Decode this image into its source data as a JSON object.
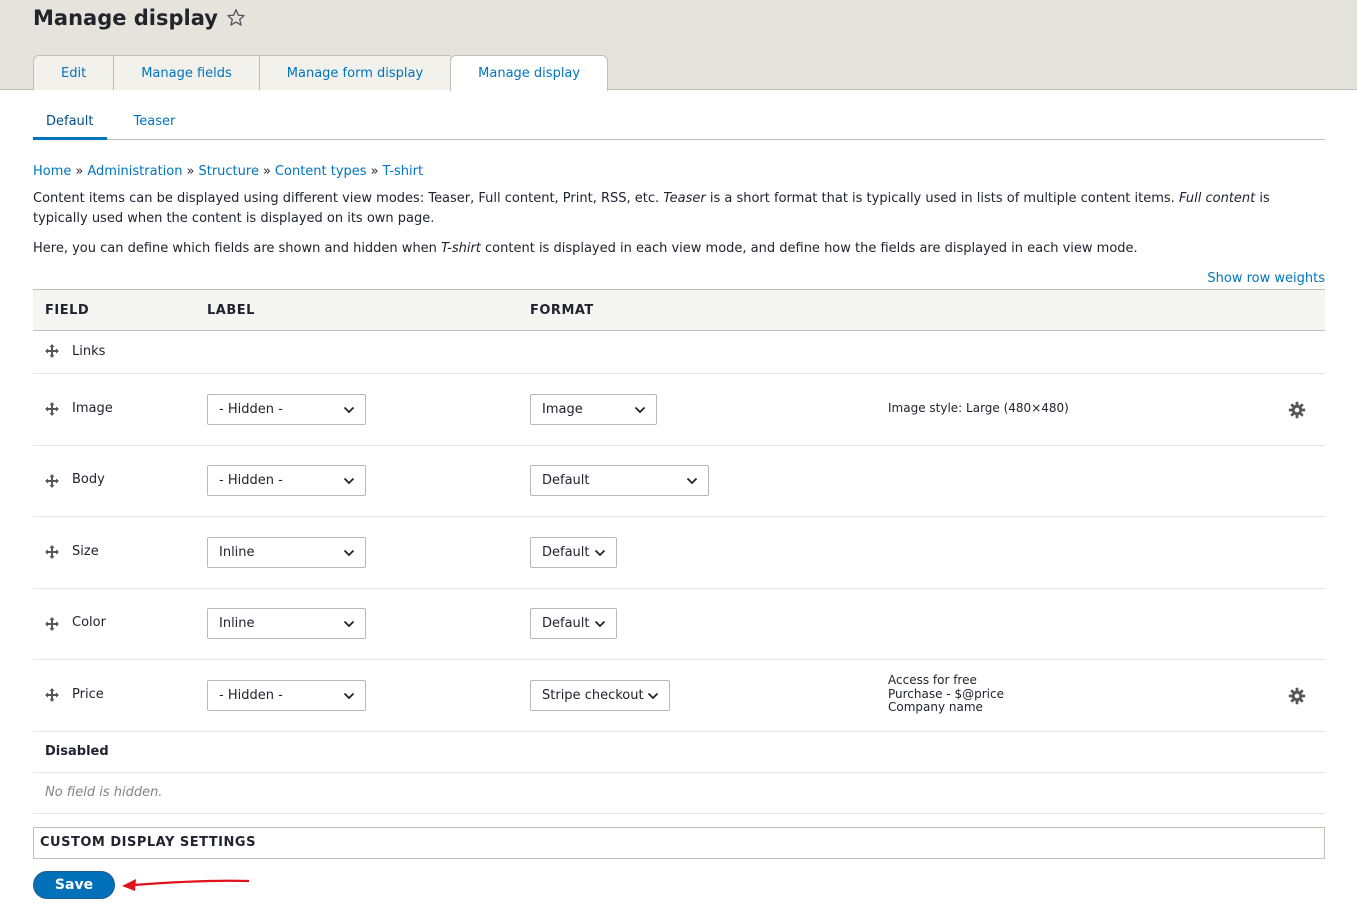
{
  "page": {
    "title": "Manage display"
  },
  "primary_tabs": [
    {
      "label": "Edit",
      "active": false
    },
    {
      "label": "Manage fields",
      "active": false
    },
    {
      "label": "Manage form display",
      "active": false
    },
    {
      "label": "Manage display",
      "active": true
    }
  ],
  "secondary_tabs": [
    {
      "label": "Default",
      "active": true
    },
    {
      "label": "Teaser",
      "active": false
    }
  ],
  "breadcrumb": [
    {
      "label": "Home"
    },
    {
      "label": "Administration"
    },
    {
      "label": "Structure"
    },
    {
      "label": "Content types"
    },
    {
      "label": "T-shirt"
    }
  ],
  "breadcrumb_separator": "»",
  "help": {
    "p1_a": "Content items can be displayed using different view modes: Teaser, Full content, Print, RSS, etc. ",
    "p1_em1": "Teaser",
    "p1_b": " is a short format that is typically used in lists of multiple content items. ",
    "p1_em2": "Full content",
    "p1_c": " is typically used when the content is displayed on its own page.",
    "p2_a": "Here, you can define which fields are shown and hidden when ",
    "p2_em": "T-shirt",
    "p2_b": " content is displayed in each view mode, and define how the fields are displayed in each view mode."
  },
  "show_row_weights": "Show row weights",
  "table": {
    "headers": {
      "field": "FIELD",
      "label": "LABEL",
      "format": "FORMAT"
    },
    "rows": [
      {
        "name": "Links",
        "label": null,
        "format": null,
        "summary": [],
        "has_settings": false
      },
      {
        "name": "Image",
        "label": "- Hidden -",
        "format": "Image",
        "summary": [
          "Image style: Large (480×480)"
        ],
        "has_settings": true
      },
      {
        "name": "Body",
        "label": "- Hidden -",
        "format": "Default",
        "summary": [],
        "has_settings": false
      },
      {
        "name": "Size",
        "label": "Inline",
        "format": "Default",
        "summary": [],
        "has_settings": false
      },
      {
        "name": "Color",
        "label": "Inline",
        "format": "Default",
        "summary": [],
        "has_settings": false
      },
      {
        "name": "Price",
        "label": "- Hidden -",
        "format": "Stripe checkout",
        "summary": [
          "Access for free",
          "Purchase - $@price",
          "Company name"
        ],
        "has_settings": true
      }
    ],
    "disabled_region": {
      "title": "Disabled",
      "empty_message": "No field is hidden."
    }
  },
  "custom_display_settings": "CUSTOM DISPLAY SETTINGS",
  "save_label": "Save",
  "colors": {
    "link": "#0074bd",
    "header_bg": "#e4e3dc",
    "button": "#0071b8",
    "annotation_arrow": "#e0121b"
  }
}
